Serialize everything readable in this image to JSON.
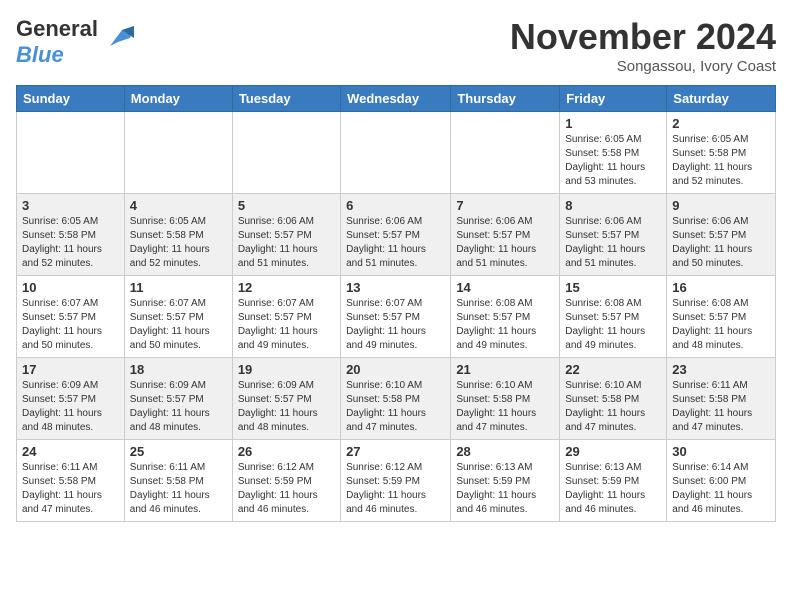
{
  "header": {
    "logo_general": "General",
    "logo_blue": "Blue",
    "month_title": "November 2024",
    "subtitle": "Songassou, Ivory Coast"
  },
  "weekdays": [
    "Sunday",
    "Monday",
    "Tuesday",
    "Wednesday",
    "Thursday",
    "Friday",
    "Saturday"
  ],
  "weeks": [
    [
      {
        "day": "",
        "info": ""
      },
      {
        "day": "",
        "info": ""
      },
      {
        "day": "",
        "info": ""
      },
      {
        "day": "",
        "info": ""
      },
      {
        "day": "",
        "info": ""
      },
      {
        "day": "1",
        "info": "Sunrise: 6:05 AM\nSunset: 5:58 PM\nDaylight: 11 hours\nand 53 minutes."
      },
      {
        "day": "2",
        "info": "Sunrise: 6:05 AM\nSunset: 5:58 PM\nDaylight: 11 hours\nand 52 minutes."
      }
    ],
    [
      {
        "day": "3",
        "info": "Sunrise: 6:05 AM\nSunset: 5:58 PM\nDaylight: 11 hours\nand 52 minutes."
      },
      {
        "day": "4",
        "info": "Sunrise: 6:05 AM\nSunset: 5:58 PM\nDaylight: 11 hours\nand 52 minutes."
      },
      {
        "day": "5",
        "info": "Sunrise: 6:06 AM\nSunset: 5:57 PM\nDaylight: 11 hours\nand 51 minutes."
      },
      {
        "day": "6",
        "info": "Sunrise: 6:06 AM\nSunset: 5:57 PM\nDaylight: 11 hours\nand 51 minutes."
      },
      {
        "day": "7",
        "info": "Sunrise: 6:06 AM\nSunset: 5:57 PM\nDaylight: 11 hours\nand 51 minutes."
      },
      {
        "day": "8",
        "info": "Sunrise: 6:06 AM\nSunset: 5:57 PM\nDaylight: 11 hours\nand 51 minutes."
      },
      {
        "day": "9",
        "info": "Sunrise: 6:06 AM\nSunset: 5:57 PM\nDaylight: 11 hours\nand 50 minutes."
      }
    ],
    [
      {
        "day": "10",
        "info": "Sunrise: 6:07 AM\nSunset: 5:57 PM\nDaylight: 11 hours\nand 50 minutes."
      },
      {
        "day": "11",
        "info": "Sunrise: 6:07 AM\nSunset: 5:57 PM\nDaylight: 11 hours\nand 50 minutes."
      },
      {
        "day": "12",
        "info": "Sunrise: 6:07 AM\nSunset: 5:57 PM\nDaylight: 11 hours\nand 49 minutes."
      },
      {
        "day": "13",
        "info": "Sunrise: 6:07 AM\nSunset: 5:57 PM\nDaylight: 11 hours\nand 49 minutes."
      },
      {
        "day": "14",
        "info": "Sunrise: 6:08 AM\nSunset: 5:57 PM\nDaylight: 11 hours\nand 49 minutes."
      },
      {
        "day": "15",
        "info": "Sunrise: 6:08 AM\nSunset: 5:57 PM\nDaylight: 11 hours\nand 49 minutes."
      },
      {
        "day": "16",
        "info": "Sunrise: 6:08 AM\nSunset: 5:57 PM\nDaylight: 11 hours\nand 48 minutes."
      }
    ],
    [
      {
        "day": "17",
        "info": "Sunrise: 6:09 AM\nSunset: 5:57 PM\nDaylight: 11 hours\nand 48 minutes."
      },
      {
        "day": "18",
        "info": "Sunrise: 6:09 AM\nSunset: 5:57 PM\nDaylight: 11 hours\nand 48 minutes."
      },
      {
        "day": "19",
        "info": "Sunrise: 6:09 AM\nSunset: 5:57 PM\nDaylight: 11 hours\nand 48 minutes."
      },
      {
        "day": "20",
        "info": "Sunrise: 6:10 AM\nSunset: 5:58 PM\nDaylight: 11 hours\nand 47 minutes."
      },
      {
        "day": "21",
        "info": "Sunrise: 6:10 AM\nSunset: 5:58 PM\nDaylight: 11 hours\nand 47 minutes."
      },
      {
        "day": "22",
        "info": "Sunrise: 6:10 AM\nSunset: 5:58 PM\nDaylight: 11 hours\nand 47 minutes."
      },
      {
        "day": "23",
        "info": "Sunrise: 6:11 AM\nSunset: 5:58 PM\nDaylight: 11 hours\nand 47 minutes."
      }
    ],
    [
      {
        "day": "24",
        "info": "Sunrise: 6:11 AM\nSunset: 5:58 PM\nDaylight: 11 hours\nand 47 minutes."
      },
      {
        "day": "25",
        "info": "Sunrise: 6:11 AM\nSunset: 5:58 PM\nDaylight: 11 hours\nand 46 minutes."
      },
      {
        "day": "26",
        "info": "Sunrise: 6:12 AM\nSunset: 5:59 PM\nDaylight: 11 hours\nand 46 minutes."
      },
      {
        "day": "27",
        "info": "Sunrise: 6:12 AM\nSunset: 5:59 PM\nDaylight: 11 hours\nand 46 minutes."
      },
      {
        "day": "28",
        "info": "Sunrise: 6:13 AM\nSunset: 5:59 PM\nDaylight: 11 hours\nand 46 minutes."
      },
      {
        "day": "29",
        "info": "Sunrise: 6:13 AM\nSunset: 5:59 PM\nDaylight: 11 hours\nand 46 minutes."
      },
      {
        "day": "30",
        "info": "Sunrise: 6:14 AM\nSunset: 6:00 PM\nDaylight: 11 hours\nand 46 minutes."
      }
    ]
  ]
}
